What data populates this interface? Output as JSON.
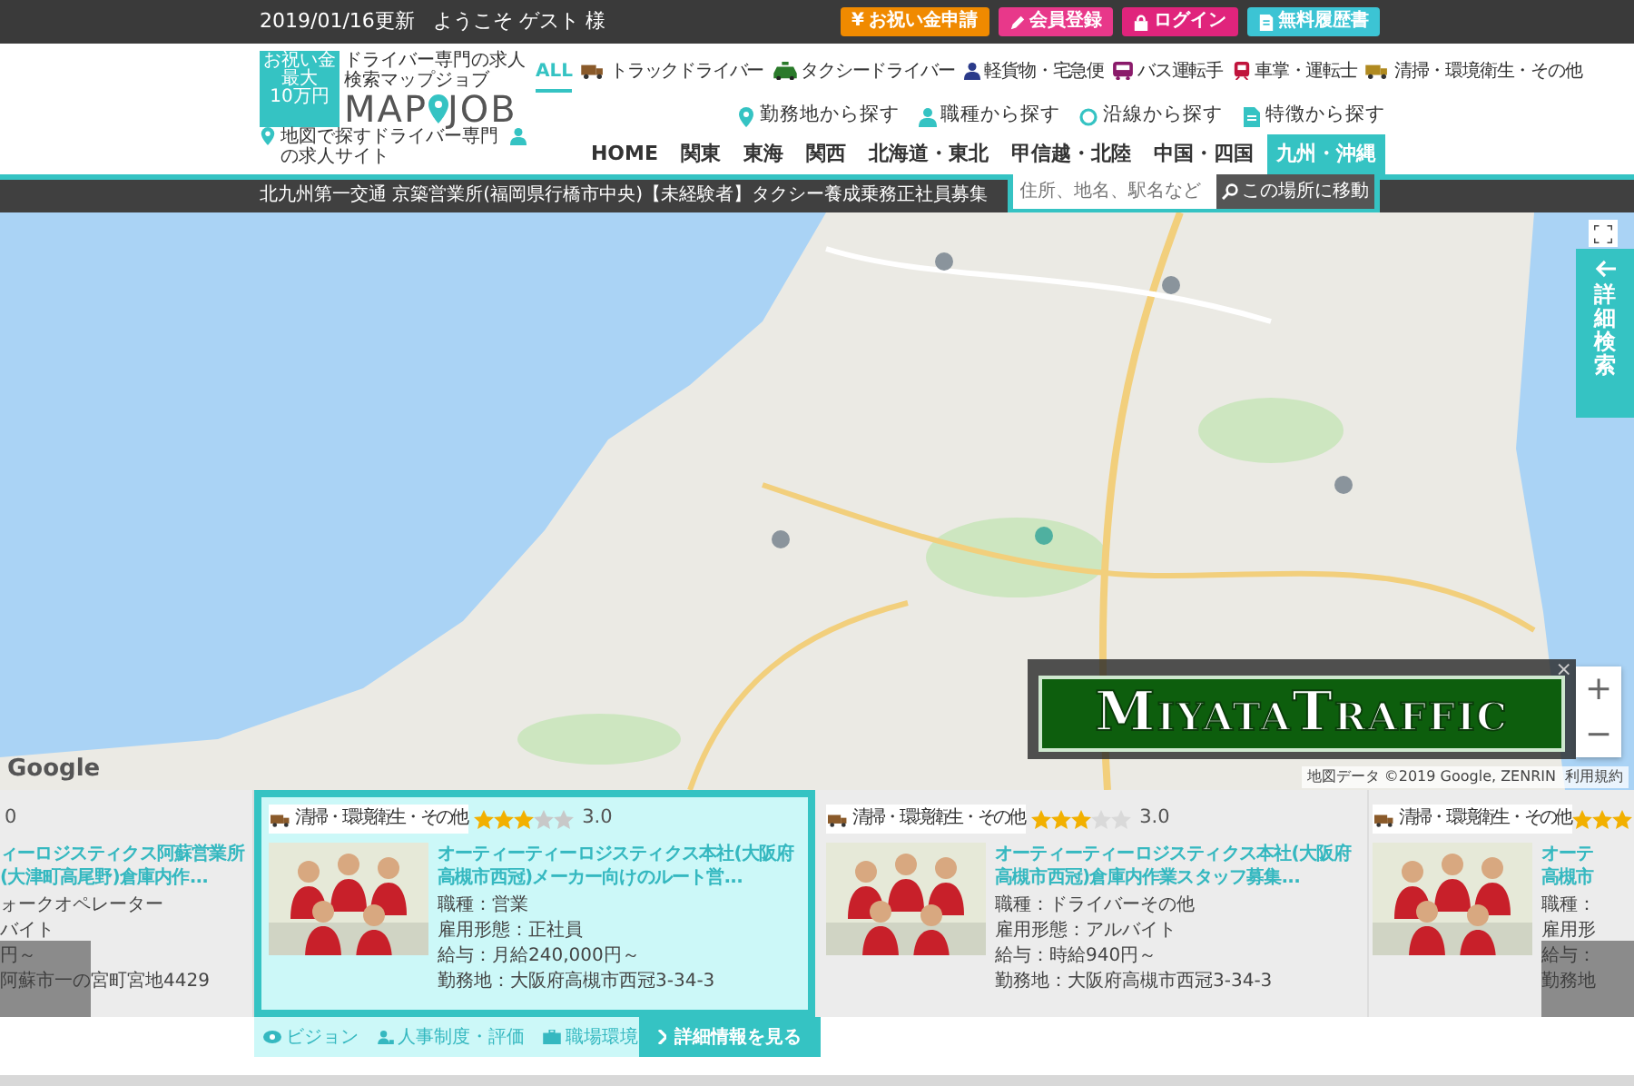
{
  "top_bar": {
    "updated": "2019/01/16更新",
    "welcome": "ようこそ ゲスト 様",
    "buttons": [
      {
        "label": "お祝い金申請",
        "kind": "gift",
        "icon_char": "¥"
      },
      {
        "label": "会員登録",
        "kind": "register"
      },
      {
        "label": "ログイン",
        "kind": "login"
      },
      {
        "label": "無料履歴書",
        "kind": "resume"
      }
    ]
  },
  "logo": {
    "badge_lines": [
      "お祝い金",
      "最大",
      "10万円"
    ],
    "tagline": "ドライバー専門の求人検索マップジョブ",
    "wordmark_left": "MAP",
    "wordmark_right": "JOB",
    "subtitle": "地図で探すドライバー専門の求人サイト"
  },
  "categories": [
    {
      "label": "ALL",
      "kind": "all",
      "selected": true
    },
    {
      "label": "トラックドライバー",
      "kind": "truck",
      "selected": false
    },
    {
      "label": "タクシードライバー",
      "kind": "taxi",
      "selected": false
    },
    {
      "label": "軽貨物・宅急便",
      "kind": "courier",
      "selected": false
    },
    {
      "label": "バス運転手",
      "kind": "bus",
      "selected": false
    },
    {
      "label": "車掌・運転士",
      "kind": "train",
      "selected": false
    },
    {
      "label": "清掃・環境衛生・その他",
      "kind": "cleaning",
      "selected": false
    }
  ],
  "search_links": [
    {
      "label": "勤務地から探す",
      "kind": "pin"
    },
    {
      "label": "職種から探す",
      "kind": "person"
    },
    {
      "label": "沿線から探す",
      "kind": "line"
    },
    {
      "label": "特徴から探す",
      "kind": "doc"
    }
  ],
  "regions": [
    {
      "label": "HOME",
      "selected": false
    },
    {
      "label": "関東",
      "selected": false
    },
    {
      "label": "東海",
      "selected": false
    },
    {
      "label": "関西",
      "selected": false
    },
    {
      "label": "北海道・東北",
      "selected": false
    },
    {
      "label": "甲信越・北陸",
      "selected": false
    },
    {
      "label": "中国・四国",
      "selected": false
    },
    {
      "label": "九州・沖縄",
      "selected": true
    }
  ],
  "job_title": "北九州第一交通 京築営業所(福岡県行橋市中央)【未経験者】タクシー養成乗務正社員募集",
  "location_search": {
    "placeholder": "住所、地名、駅名など",
    "button": "この場所に移動"
  },
  "map": {
    "kind": "picture",
    "side_tab": "詳細検索",
    "zoom_in": "+",
    "zoom_out": "−",
    "google": "Google",
    "attribution": "地図データ ©2019 Google, ZENRIN",
    "terms": "利用規約",
    "ad": {
      "text": "MiyataTraffic",
      "close": "×"
    }
  },
  "cards": [
    {
      "kind": "partial_left",
      "selected": false,
      "rating": "0",
      "title_lines": [
        "ィーロジスティクス阿蘇営業所",
        "(大津町高尾野)倉庫内作..."
      ],
      "details": [
        "ォークオペレーター",
        "バイト",
        "円～",
        "阿蘇市一の宮町宮地4429"
      ]
    },
    {
      "kind": "full",
      "selected": true,
      "category": "清掃・環境衛生・その他",
      "stars": 3,
      "rating": "3.0",
      "title_lines": [
        "オーティーティーロジスティクス本社(大阪府",
        "高槻市西冠)メーカー向けのルート営..."
      ],
      "details": [
        "職種：営業",
        "雇用形態：正社員",
        "給与：月給240,000円～",
        "勤務地：大阪府高槻市西冠3-34-3"
      ]
    },
    {
      "kind": "full",
      "selected": false,
      "category": "清掃・環境衛生・その他",
      "stars": 3,
      "rating": "3.0",
      "title_lines": [
        "オーティーティーロジスティクス本社(大阪府",
        "高槻市西冠)倉庫内作業スタッフ募集..."
      ],
      "details": [
        "職種：ドライバーその他",
        "雇用形態：アルバイト",
        "給与：時給940円～",
        "勤務地：大阪府高槻市西冠3-34-3"
      ]
    },
    {
      "kind": "partial_right",
      "selected": false,
      "category": "清掃・環境衛生・その他",
      "stars": 3,
      "title_lines": [
        "オーテ",
        "高槻市"
      ],
      "details": [
        "職種：",
        "雇用形",
        "給与：",
        "勤務地"
      ]
    }
  ],
  "selected_card_footer": {
    "links": [
      {
        "label": "ビジョン",
        "kind": "vision"
      },
      {
        "label": "人事制度・評価",
        "kind": "people"
      },
      {
        "label": "職場環境",
        "kind": "office"
      }
    ],
    "button": "詳細情報を見る"
  }
}
